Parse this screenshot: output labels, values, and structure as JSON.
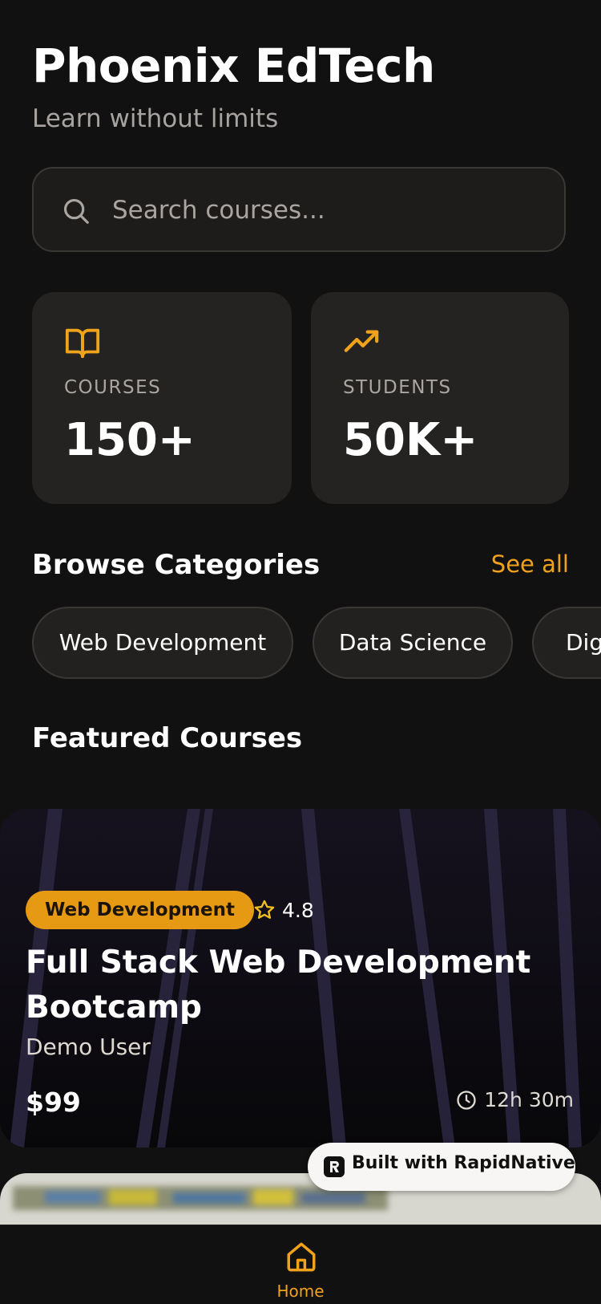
{
  "header": {
    "title": "Phoenix EdTech",
    "subtitle": "Learn without limits"
  },
  "search": {
    "placeholder": "Search courses...",
    "icon": "search-icon"
  },
  "stats": [
    {
      "icon": "open-book-icon",
      "label": "COURSES",
      "value": "150+"
    },
    {
      "icon": "trending-up-icon",
      "label": "STUDENTS",
      "value": "50K+"
    }
  ],
  "categories": {
    "title": "Browse Categories",
    "see_all": "See all",
    "items": [
      "Web Development",
      "Data Science",
      "Dig"
    ]
  },
  "featured": {
    "title": "Featured Courses",
    "courses": [
      {
        "category": "Web Development",
        "rating": "4.8",
        "title": "Full Stack Web Development Bootcamp",
        "author": "Demo User",
        "price": "$99",
        "duration": "12h 30m"
      }
    ]
  },
  "badge": {
    "text": "Built with RapidNative"
  },
  "tabs": [
    {
      "label": "Home",
      "icon": "home-icon",
      "active": true
    }
  ],
  "colors": {
    "background": "#121111",
    "card": "#252321",
    "accent": "#f0a21a",
    "muted_text": "#a9a6a2"
  }
}
